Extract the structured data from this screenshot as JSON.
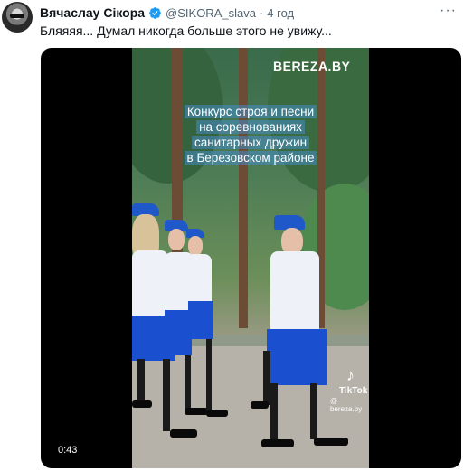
{
  "tweet": {
    "author_name": "Вячаслау Сікора",
    "author_handle": "@SIKORA_slava",
    "separator": "·",
    "time": "4 год",
    "more": "···",
    "text": "Бляяяя... Думал никогда больше этого не увижу..."
  },
  "video": {
    "watermark": "BEREZA.BY",
    "caption_lines": [
      "Конкурс строя и песни",
      "на соревнованиях",
      "санитарных дружин",
      "в Березовском районе"
    ],
    "tiktok_label": "TikTok",
    "tiktok_handle": "@ bereza.by",
    "duration": "0:43"
  },
  "colors": {
    "verified_badge": "#1d9bf0",
    "secondary_text": "#536471",
    "uniform_blue": "#1a4fd0"
  },
  "icons": {
    "verified": "verified-badge-icon",
    "more": "more-icon",
    "tiktok": "tiktok-logo-icon"
  }
}
